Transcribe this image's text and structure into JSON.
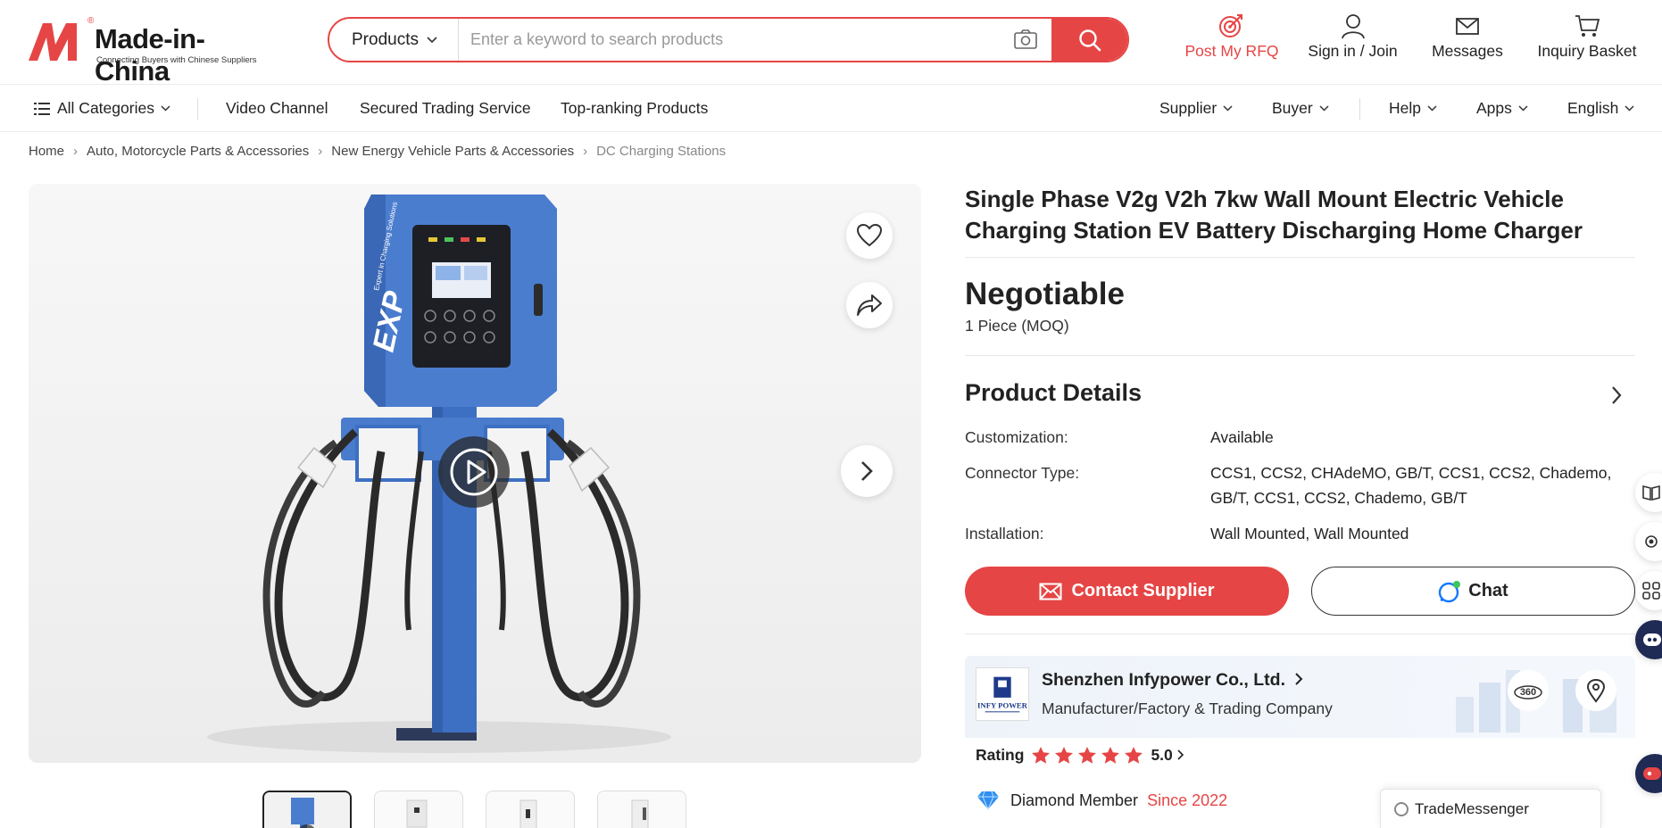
{
  "brand": {
    "name": "Made-in-China",
    "tagline": "Connecting Buyers with Chinese Suppliers",
    "registered": "®",
    "accent": "#e64545"
  },
  "search": {
    "category": "Products",
    "placeholder": "Enter a keyword to search products"
  },
  "top_actions": {
    "rfq": "Post My RFQ",
    "signin": "Sign in / Join",
    "messages": "Messages",
    "basket": "Inquiry Basket"
  },
  "nav": {
    "all_categories": "All Categories",
    "video_channel": "Video Channel",
    "secured_trading": "Secured Trading Service",
    "top_ranking": "Top-ranking Products",
    "supplier": "Supplier",
    "buyer": "Buyer",
    "help": "Help",
    "apps": "Apps",
    "language": "English"
  },
  "breadcrumb": [
    "Home",
    "Auto, Motorcycle Parts & Accessories",
    "New Energy Vehicle Parts & Accessories",
    "DC Charging Stations"
  ],
  "product": {
    "title_line1": "Single Phase V2g V2h 7kw Wall Mount Electric Vehicle",
    "title_line2": "Charging Station EV Battery Discharging Home Charger",
    "price": "Negotiable",
    "moq": "1 Piece (MOQ)",
    "details_heading": "Product Details",
    "specs": [
      {
        "label": "Customization:",
        "value": "Available"
      },
      {
        "label": "Connector Type:",
        "value_line1": "CCS1, CCS2, CHAdeMO, GB/T, CCS1, CCS2, Chademo,",
        "value_line2": "GB/T, CCS1, CCS2, Chademo, GB/T"
      },
      {
        "label": "Installation:",
        "value": "Wall Mounted, Wall Mounted"
      }
    ],
    "image_brand": "EXP",
    "image_brand_sub": "Expert in Charging Solutions"
  },
  "buttons": {
    "contact": "Contact Supplier",
    "chat": "Chat"
  },
  "supplier": {
    "name": "Shenzhen Infypower Co., Ltd.",
    "type": "Manufacturer/Factory & Trading Company",
    "tour_label": "360",
    "logo_text": "INFY POWER",
    "rating_label": "Rating",
    "rating_value": "5.0",
    "rating_stars": 5,
    "member": "Diamond Member",
    "since": "Since 2022"
  },
  "trade_messenger": "TradeMessenger",
  "icons": {
    "cam": "camera-icon",
    "search": "search-icon",
    "rfq": "target-icon",
    "user": "user-icon",
    "mail": "mail-icon",
    "cart": "cart-icon",
    "heart": "heart-icon",
    "share": "share-icon",
    "next": "chevron-right-icon",
    "play": "play-icon"
  }
}
